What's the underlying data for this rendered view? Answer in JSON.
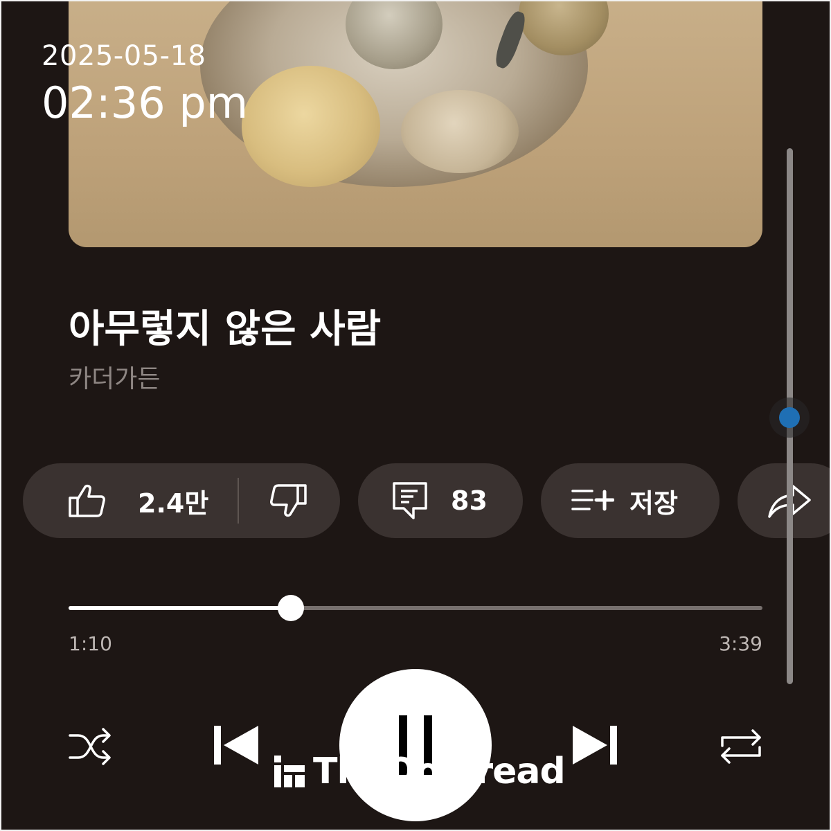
{
  "overlay": {
    "date": "2025-05-18",
    "time": "02:36 pm"
  },
  "song": {
    "title": "아무렇지 않은 사람",
    "artist": "카더가든"
  },
  "actions": {
    "like_count": "2.4만",
    "comment_count": "83",
    "save_label": "저장"
  },
  "progress": {
    "current": "1:10",
    "duration": "3:39",
    "fraction": 0.32
  },
  "controls": [
    "shuffle-icon",
    "previous-icon",
    "pause-icon",
    "next-icon",
    "repeat-icon"
  ],
  "watermark": {
    "text": "TheQoo read"
  },
  "colors": {
    "background": "#1d1614",
    "pill": "#3a3230",
    "accent_scroll": "#1f6fb4"
  }
}
